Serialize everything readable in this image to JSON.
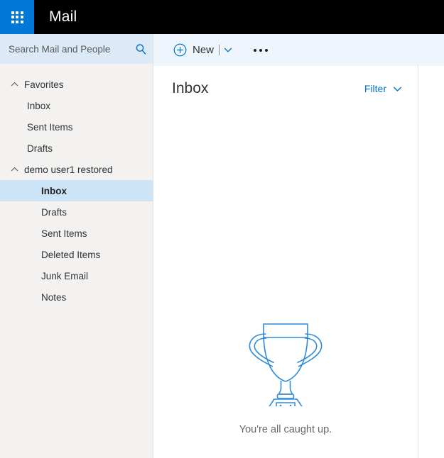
{
  "suite_bar": {
    "waffle_icon": "app-launcher-waffle-icon",
    "app_title": "Mail"
  },
  "search": {
    "placeholder": "Search Mail and People",
    "value": "",
    "icon": "search-icon"
  },
  "navigation": {
    "groups": [
      {
        "label": "Favorites",
        "twisty_icon": "chevron-up-icon",
        "expanded": true,
        "items": [
          {
            "label": "Inbox",
            "selected": false
          },
          {
            "label": "Sent Items",
            "selected": false
          },
          {
            "label": "Drafts",
            "selected": false
          }
        ]
      },
      {
        "label": "demo user1 restored",
        "twisty_icon": "chevron-up-icon",
        "expanded": true,
        "items": [
          {
            "label": "Inbox",
            "selected": true
          },
          {
            "label": "Drafts",
            "selected": false
          },
          {
            "label": "Sent Items",
            "selected": false
          },
          {
            "label": "Deleted Items",
            "selected": false
          },
          {
            "label": "Junk Email",
            "selected": false
          },
          {
            "label": "Notes",
            "selected": false
          }
        ]
      }
    ]
  },
  "command_bar": {
    "new_label": "New",
    "new_icon": "circle-plus-icon",
    "new_caret_icon": "chevron-down-icon",
    "more_label": "...",
    "more_icon": "ellipsis-icon"
  },
  "list_pane": {
    "folder_title": "Inbox",
    "filter_label": "Filter",
    "filter_caret_icon": "chevron-down-icon",
    "empty_state": {
      "illustration": "trophy-icon",
      "message": "You're all caught up."
    }
  },
  "colors": {
    "accent_blue": "#0078d7",
    "link_blue": "#0072c6",
    "suite_bar_black": "#000000",
    "rail_gray": "#f3f2f1",
    "search_blue": "#dce9f7",
    "command_bar_blue": "#eff5fc",
    "selected_blue": "#cce4f7",
    "trophy_blue": "#2e8bd8",
    "text_dark": "#333333",
    "text_muted": "#666666"
  }
}
